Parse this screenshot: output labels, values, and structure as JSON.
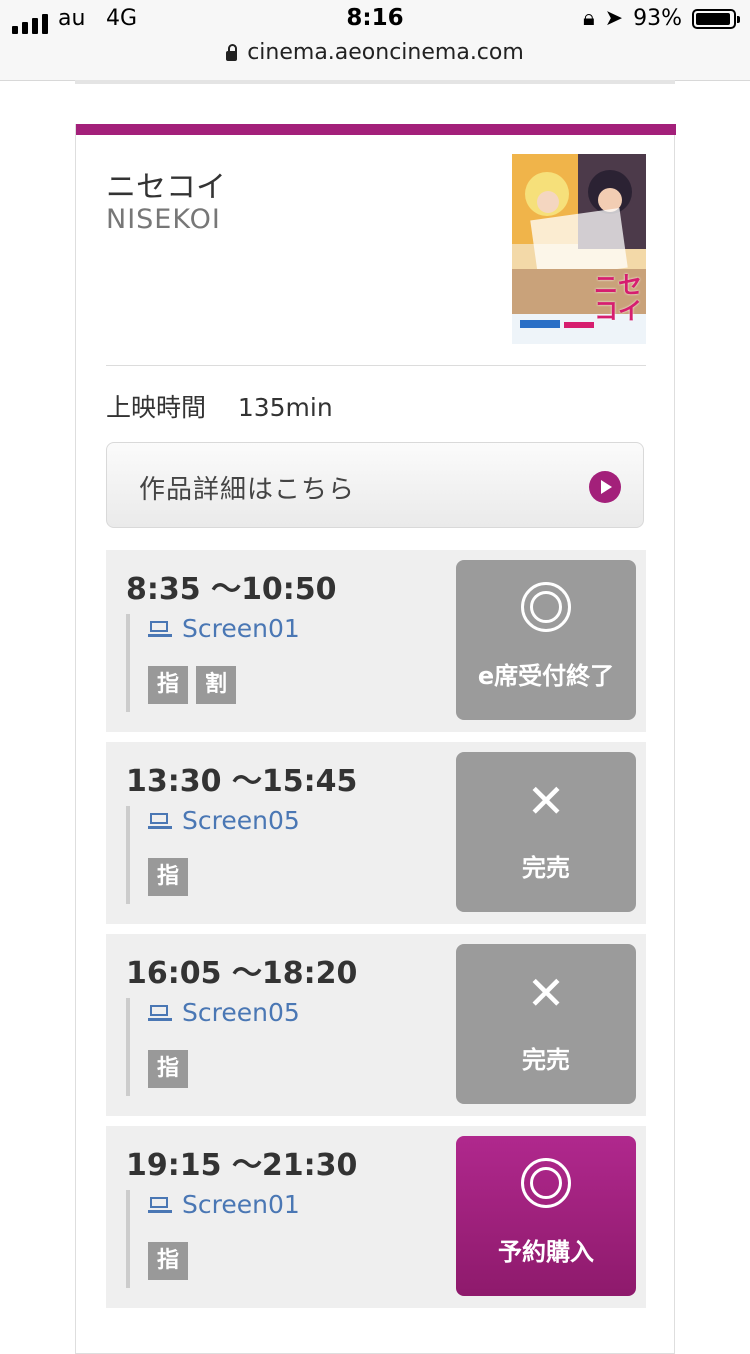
{
  "status_bar": {
    "carrier": "au",
    "network": "4G",
    "time": "8:16",
    "battery": "93%",
    "url": "cinema.aeoncinema.com"
  },
  "movie": {
    "title_ja": "ニセコイ",
    "title_en": "NISEKOI",
    "poster_text": "ニセ\nコイ",
    "runtime_label": "上映時間",
    "runtime_value": "135min",
    "detail_button_label": "作品詳細はこちら"
  },
  "showtimes": [
    {
      "time": "8:35 〜10:50",
      "screen": "Screen01",
      "badges": [
        "指",
        "割"
      ],
      "status_icon": "double-circle",
      "status_label": "e席受付終了",
      "active": false
    },
    {
      "time": "13:30 〜15:45",
      "screen": "Screen05",
      "badges": [
        "指"
      ],
      "status_icon": "cross",
      "status_label": "完売",
      "active": false
    },
    {
      "time": "16:05 〜18:20",
      "screen": "Screen05",
      "badges": [
        "指"
      ],
      "status_icon": "cross",
      "status_label": "完売",
      "active": false
    },
    {
      "time": "19:15 〜21:30",
      "screen": "Screen01",
      "badges": [
        "指"
      ],
      "status_icon": "double-circle",
      "status_label": "予約購入",
      "active": true
    }
  ],
  "colors": {
    "accent": "#a3207a",
    "link": "#4a77b4",
    "disabled_button": "#9b9b9b"
  }
}
